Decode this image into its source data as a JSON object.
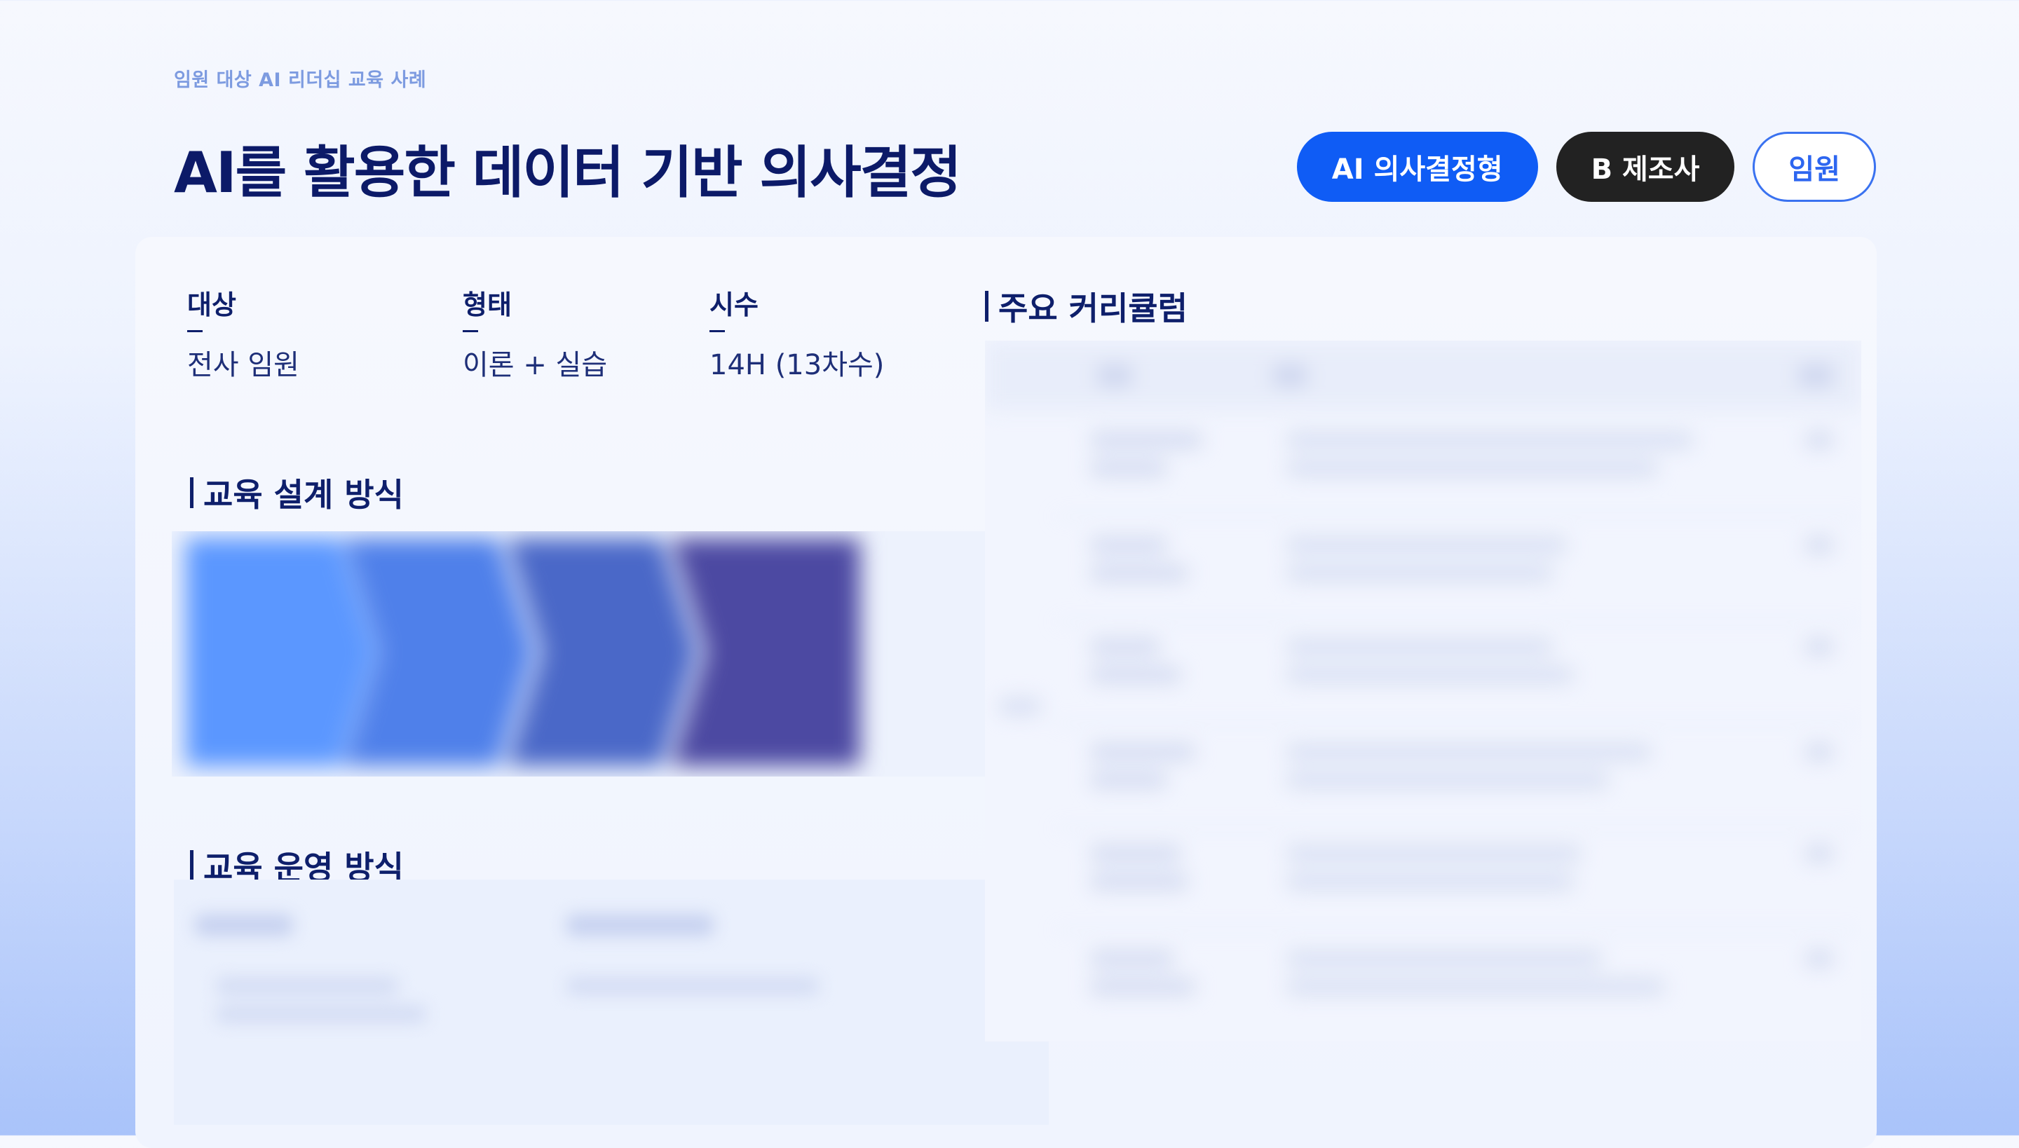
{
  "header": {
    "eyebrow": "임원 대상 AI 리더십 교육 사례",
    "title": "AI를 활용한 데이터 기반 의사결정"
  },
  "tags": [
    {
      "label": "AI 의사결정형",
      "style": "blue"
    },
    {
      "label": "B 제조사",
      "style": "dark"
    },
    {
      "label": "임원",
      "style": "outline"
    }
  ],
  "info": {
    "target": {
      "label": "대상",
      "value": "전사 임원"
    },
    "format": {
      "label": "형태",
      "value": "이론 + 실습"
    },
    "hours": {
      "label": "시수",
      "value": "14H (13차수)"
    }
  },
  "sections": {
    "design": "교육 설계 방식",
    "operation": "교육 운영 방식",
    "curriculum": "주요 커리큘럼"
  },
  "colors": {
    "flow_steps": [
      "#5b97ff",
      "#4f80ea",
      "#4a68c8",
      "#4c49a2"
    ]
  }
}
